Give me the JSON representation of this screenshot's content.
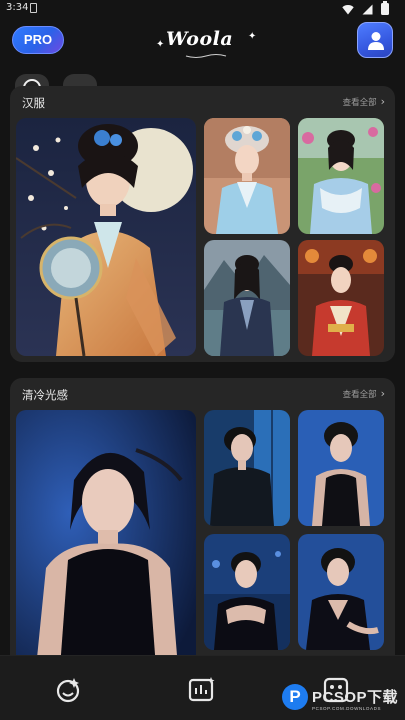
{
  "status_bar": {
    "time": "3:34"
  },
  "header": {
    "pro_label": "PRO",
    "logo_text": "Woola"
  },
  "sections": [
    {
      "title": "汉服",
      "see_all": "查看全部",
      "photos": [
        {
          "name": "hanfu-moon-fan-portrait",
          "size": "large"
        },
        {
          "name": "hanfu-blue-crown-portrait",
          "size": "small"
        },
        {
          "name": "hanfu-garden-portrait",
          "size": "small"
        },
        {
          "name": "hanfu-lake-portrait",
          "size": "small"
        },
        {
          "name": "hanfu-red-robe-portrait",
          "size": "small"
        }
      ]
    },
    {
      "title": "清冷光感",
      "see_all": "查看全部",
      "photos": [
        {
          "name": "blue-light-sleeveless-portrait",
          "size": "large"
        },
        {
          "name": "blue-window-jacket-portrait",
          "size": "small"
        },
        {
          "name": "blue-black-dress-portrait",
          "size": "small"
        },
        {
          "name": "blue-night-shoulder-portrait",
          "size": "small"
        },
        {
          "name": "blue-seated-portrait",
          "size": "small"
        }
      ]
    }
  ],
  "tab_bar": {
    "tabs": [
      {
        "icon": "face-sparkle-icon"
      },
      {
        "icon": "gallery-sparkle-icon"
      },
      {
        "icon": "frame-icon"
      }
    ]
  },
  "watermark": {
    "badge": "P",
    "text": "PCSOP下载",
    "sub": "PCSOP.COM.DOWNLOADS"
  }
}
